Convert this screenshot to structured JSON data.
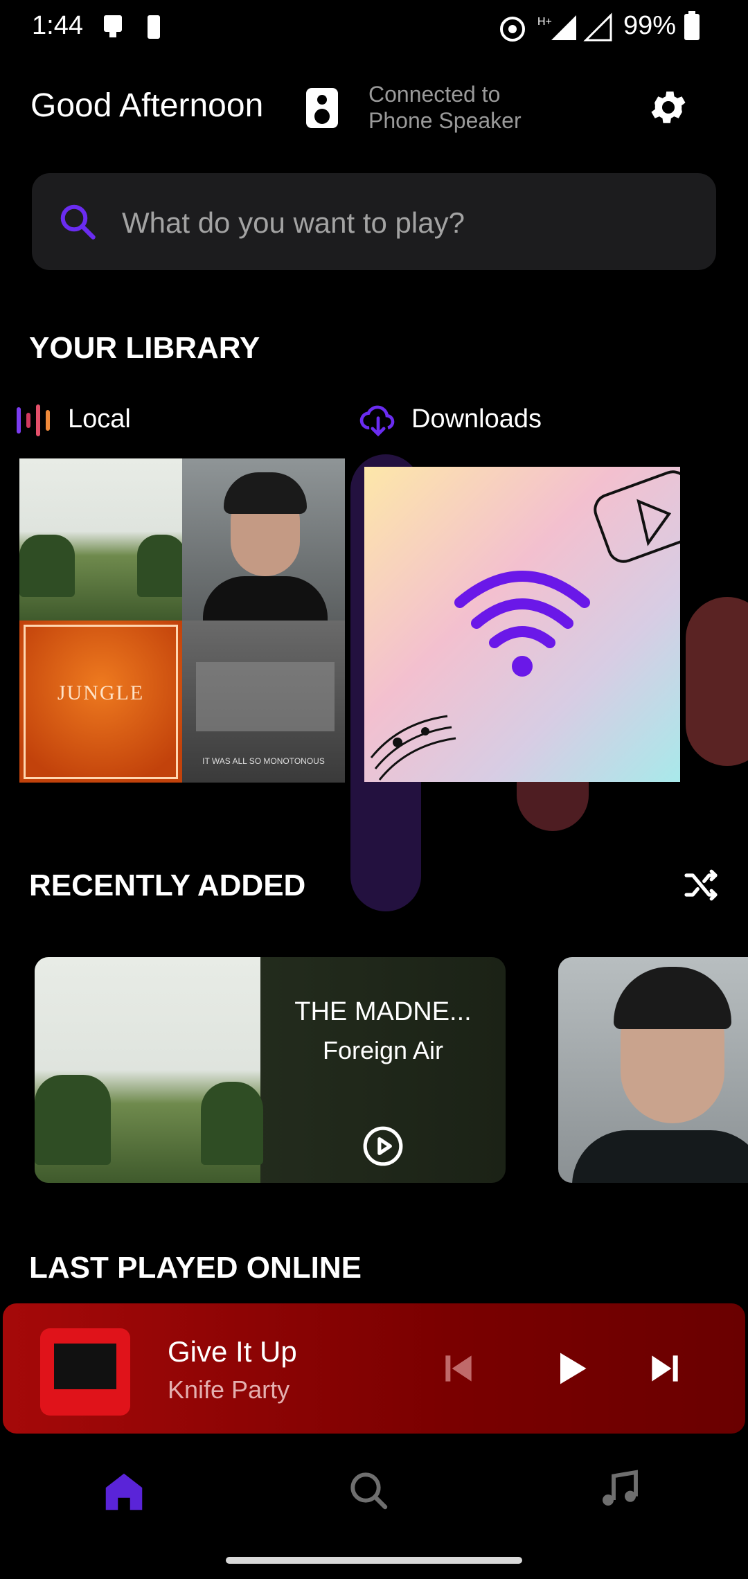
{
  "status_bar": {
    "time": "1:44",
    "battery_percent": "99%"
  },
  "header": {
    "greeting": "Good Afternoon",
    "connection_line1": "Connected to",
    "connection_line2": "Phone Speaker"
  },
  "search": {
    "placeholder": "What do you want to play?"
  },
  "library": {
    "title": "YOUR LIBRARY",
    "local_label": "Local",
    "downloads_label": "Downloads",
    "jungle_text": "JUNGLE",
    "monotonous_text": "IT WAS ALL SO MONOTONOUS"
  },
  "recently_added": {
    "title": "RECENTLY ADDED",
    "items": [
      {
        "title": "THE MADNE...",
        "artist": "Foreign Air"
      }
    ]
  },
  "last_played_online": {
    "title": "LAST PLAYED ONLINE"
  },
  "player": {
    "title": "Give It Up",
    "artist": "Knife Party"
  },
  "colors": {
    "accent": "#6a2cf0",
    "player_bg": "#a50909",
    "nav_active": "#5a24d8"
  },
  "icons": [
    "settings-gear-icon",
    "search-icon",
    "local-equalizer-icon",
    "download-cloud-icon",
    "shuffle-icon",
    "play-circle-icon",
    "previous-icon",
    "play-icon",
    "next-icon",
    "home-icon",
    "music-note-icon"
  ]
}
